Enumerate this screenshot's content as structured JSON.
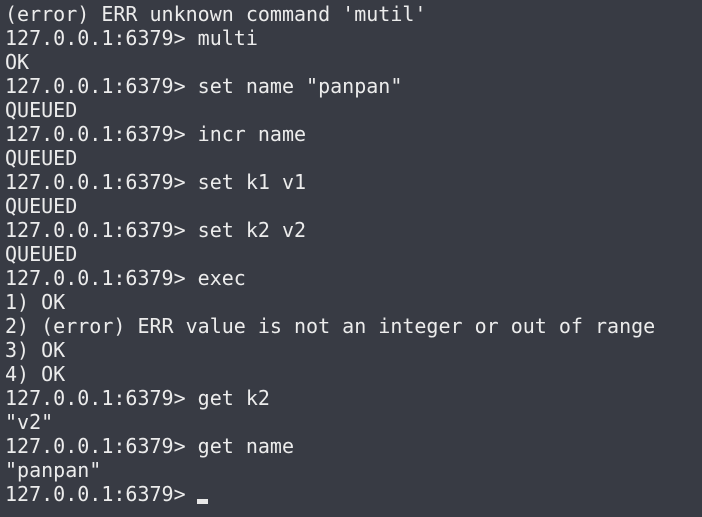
{
  "terminal": {
    "lines": [
      "(error) ERR unknown command 'mutil'",
      "127.0.0.1:6379> multi",
      "OK",
      "127.0.0.1:6379> set name \"panpan\"",
      "QUEUED",
      "127.0.0.1:6379> incr name",
      "QUEUED",
      "127.0.0.1:6379> set k1 v1",
      "QUEUED",
      "127.0.0.1:6379> set k2 v2",
      "QUEUED",
      "127.0.0.1:6379> exec",
      "1) OK",
      "2) (error) ERR value is not an integer or out of range",
      "3) OK",
      "4) OK",
      "127.0.0.1:6379> get k2",
      "\"v2\"",
      "127.0.0.1:6379> get name",
      "\"panpan\""
    ],
    "current_prompt": "127.0.0.1:6379>"
  }
}
